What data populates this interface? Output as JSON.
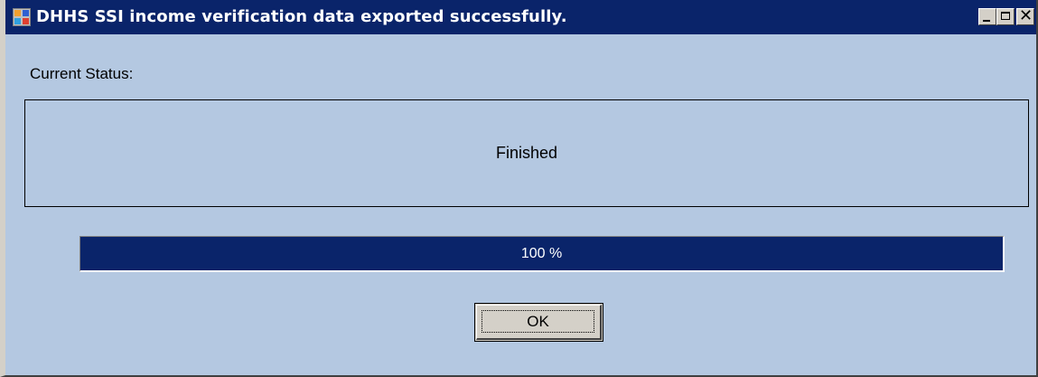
{
  "window": {
    "title": "DHHS SSI income verification data exported successfully.",
    "icon": "application-window-icon",
    "controls": {
      "minimize": "minimize-icon",
      "maximize": "maximize-icon",
      "close": "close-icon",
      "close_glyph": "✕"
    }
  },
  "status": {
    "label": "Current Status:",
    "message": "Finished"
  },
  "progress": {
    "value": 100,
    "text": "100 %"
  },
  "buttons": {
    "ok_label": "OK"
  },
  "colors": {
    "title_bar": "#0a246a",
    "background": "#b4c8e1",
    "progress_fill": "#0a246a"
  }
}
